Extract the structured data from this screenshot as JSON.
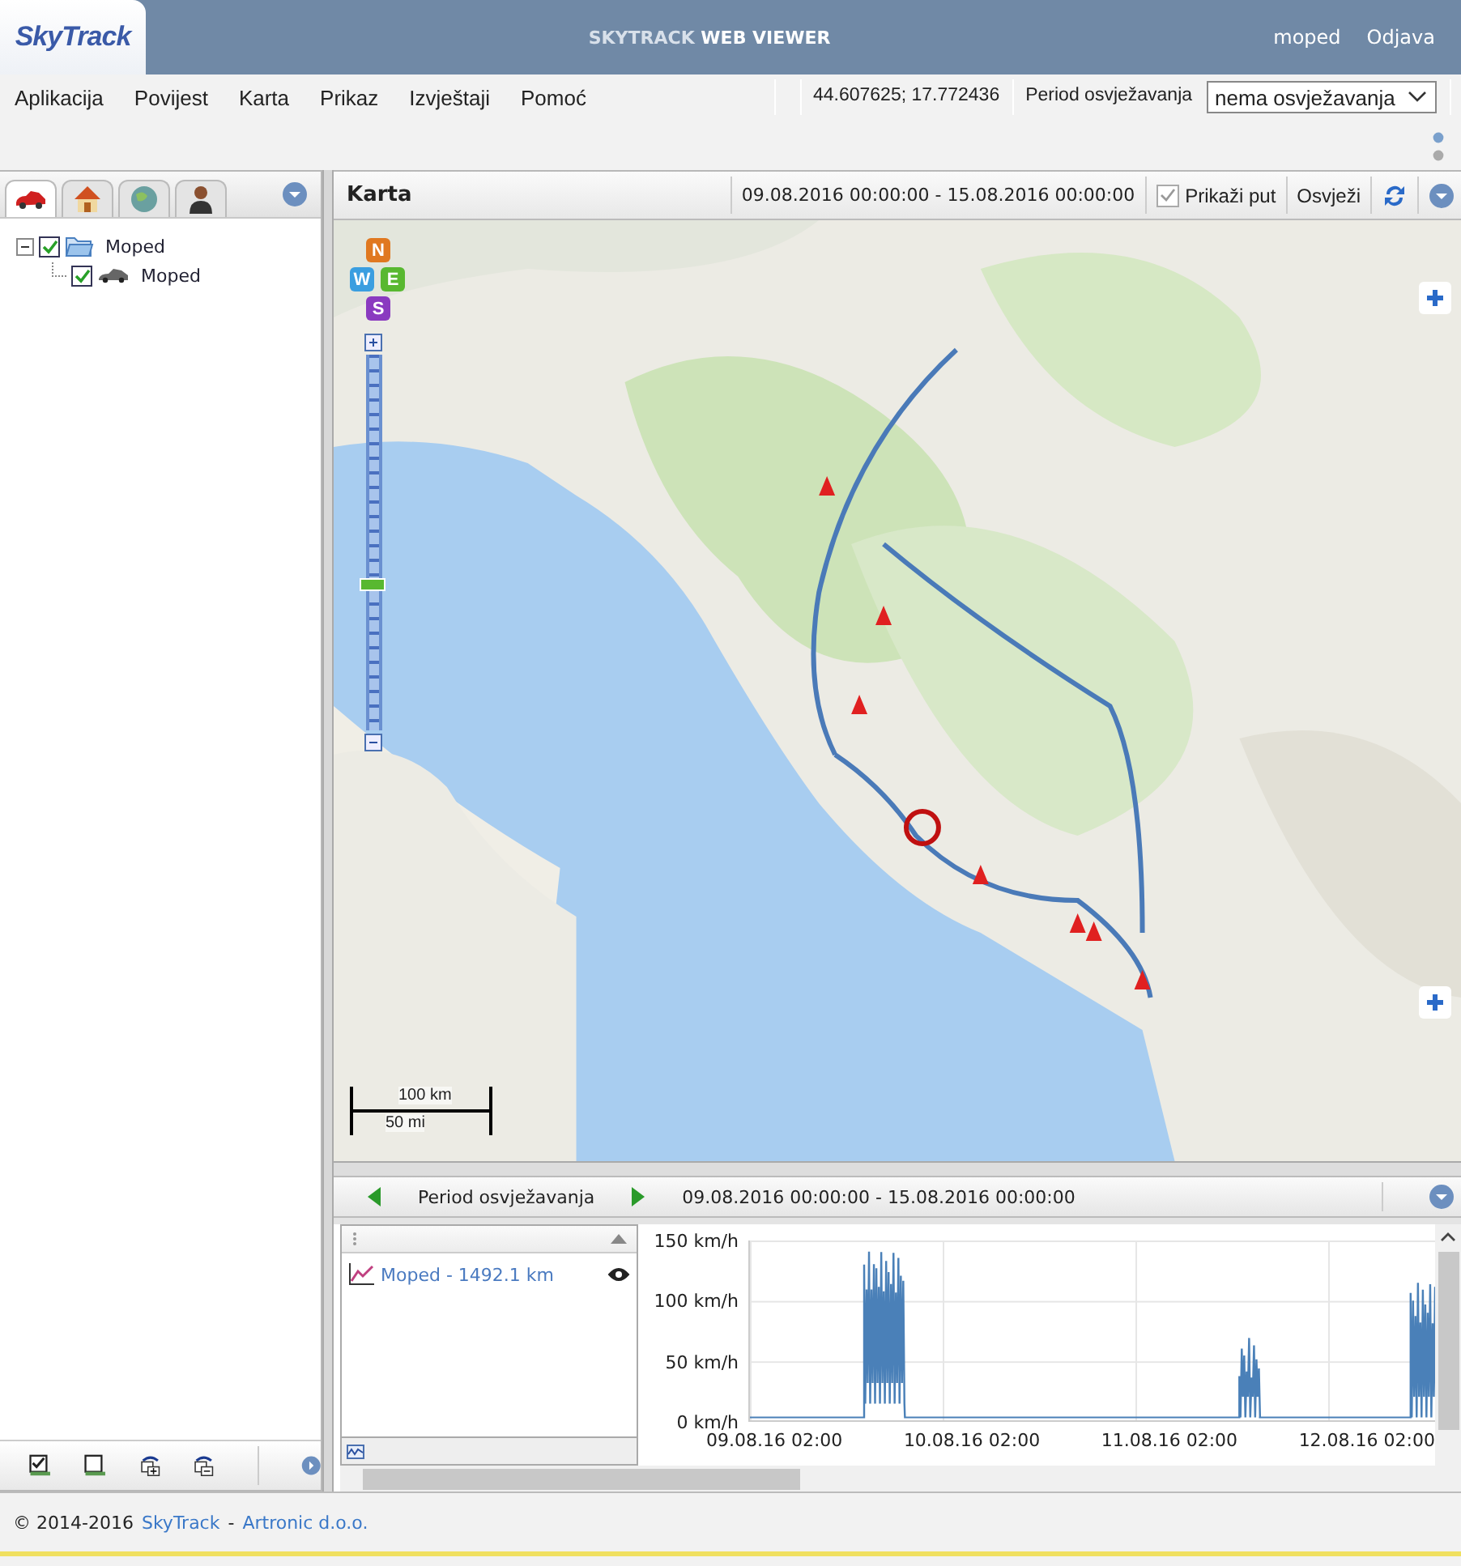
{
  "header": {
    "logo": "SkyTrack",
    "title_light": "SKYTRACK",
    "title_bold": "WEB VIEWER",
    "user": "moped",
    "logout": "Odjava"
  },
  "menu": [
    "Aplikacija",
    "Povijest",
    "Karta",
    "Prikaz",
    "Izvještaji",
    "Pomoć"
  ],
  "coordinates": "44.607625; 17.772436",
  "refresh": {
    "label": "Period osvježavanja",
    "value": "nema osvježavanja"
  },
  "left_tabs": [
    {
      "kind": "car",
      "selected": true
    },
    {
      "kind": "home",
      "selected": false
    },
    {
      "kind": "globe",
      "selected": false
    },
    {
      "kind": "person",
      "selected": false
    }
  ],
  "tree": [
    {
      "label": "Moped",
      "kind": "folder",
      "checked": true,
      "expanded": true,
      "children": [
        {
          "label": "Moped",
          "kind": "vehicle",
          "checked": true
        }
      ]
    }
  ],
  "map_panel": {
    "title": "Karta",
    "range": "09.08.2016 00:00:00 - 15.08.2016 00:00:00",
    "show_route": {
      "label": "Prikaži put",
      "checked": true,
      "disabled": true
    },
    "refresh": "Osvježi"
  },
  "compass": [
    "N",
    "W",
    "E",
    "S"
  ],
  "zoom": {
    "level": 0.37
  },
  "scale": {
    "metric": "100 km",
    "imperial": "50 mi"
  },
  "timeline": {
    "label": "Period osvježavanja",
    "range": "09.08.2016 00:00:00 - 15.08.2016 00:00:00"
  },
  "legend": [
    {
      "label": "Moped - 1492.1 km",
      "visible": true
    }
  ],
  "chart": {
    "y_labels": [
      "150 km/h",
      "100 km/h",
      "50 km/h",
      "0 km/h"
    ],
    "x_labels": [
      "09.08.16 02:00",
      "10.08.16 02:00",
      "11.08.16 02:00",
      "12.08.16 02:00"
    ]
  },
  "footer": {
    "copyright": "© 2014-2016",
    "link1": "SkyTrack",
    "separator": "-",
    "link2": "Artronic d.o.o."
  }
}
